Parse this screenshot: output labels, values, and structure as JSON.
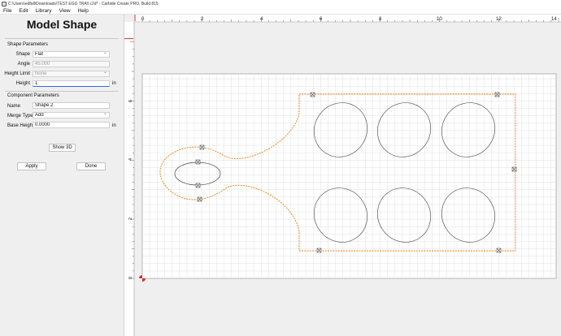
{
  "window": {
    "title": "C:\\Users\\edfall\\Downloads\\TEST EGG TRAY.c2d* - Carbide Create PRO, Build 815"
  },
  "menu": [
    "File",
    "Edit",
    "Library",
    "View",
    "Help"
  ],
  "panel": {
    "title": "Model Shape",
    "shape_section": "Shape Parameters",
    "shape_label": "Shape",
    "shape_value": "Flat",
    "angle_label": "Angle",
    "angle_value": "45.000",
    "height_limit_label": "Height Limit",
    "height_limit_value": "None",
    "height_label": "Height",
    "height_value": "1",
    "height_unit": "in",
    "component_section": "Component Parameters",
    "name_label": "Name",
    "name_value": "Shape 2",
    "merge_label": "Merge Type",
    "merge_value": "Add",
    "base_label": "Base Height",
    "base_value": "0.0000",
    "base_unit": "in",
    "show3d_label": "Show 3D",
    "apply_label": "Apply",
    "done_label": "Done"
  },
  "ruler": {
    "x_labels": [
      "0",
      "2",
      "4",
      "6",
      "8",
      "10",
      "12",
      "14"
    ],
    "y_labels": [
      "6",
      "4",
      "2",
      "0"
    ]
  },
  "colors": {
    "accent_orange": "#f07d1a",
    "grid": "#d8d8d8",
    "ruler_red": "#d32f2f"
  }
}
